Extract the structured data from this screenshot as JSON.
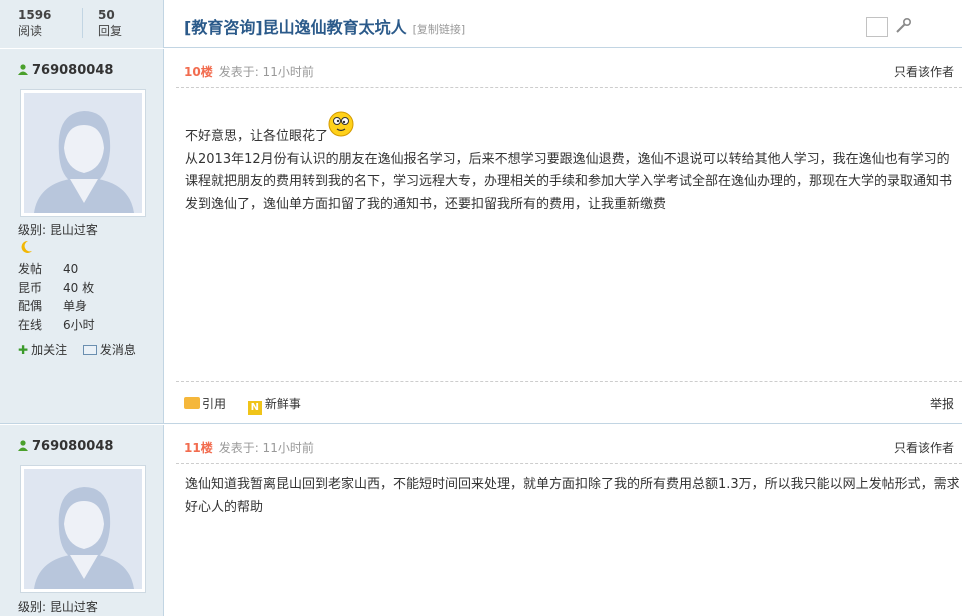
{
  "thread": {
    "views": "1596",
    "views_label": "阅读",
    "replies": "50",
    "replies_label": "回复",
    "title": "[教育咨询]昆山逸仙教育太坑人",
    "copy_link": "[复制链接]"
  },
  "posts": [
    {
      "author": "769080048",
      "level_label": "级别:",
      "level": "昆山过客",
      "stats": [
        {
          "k": "发帖",
          "v": "40"
        },
        {
          "k": "昆币",
          "v": "40 枚"
        },
        {
          "k": "配偶",
          "v": "单身"
        },
        {
          "k": "在线",
          "v": "6小时"
        }
      ],
      "follow": "加关注",
      "message_user": "发消息",
      "floor": "10楼",
      "posted": "发表于: 11小时前",
      "only_author": "只看该作者",
      "line1": "不好意思，让各位眼花了",
      "line2": "从2013年12月份有认识的朋友在逸仙报名学习，后来不想学习要跟逸仙退费，逸仙不退说可以转给其他人学习，我在逸仙也有学习的课程就把朋友的费用转到我的名下，学习远程大专，办理相关的手续和参加大学入学考试全部在逸仙办理的，那现在大学的录取通知书发到逸仙了，逸仙单方面扣留了我的通知书，还要扣留我所有的费用，让我重新缴费",
      "quote": "引用",
      "fresh": "新鲜事",
      "report": "举报"
    },
    {
      "author": "769080048",
      "level_label": "级别:",
      "level": "昆山过客",
      "floor": "11楼",
      "posted": "发表于: 11小时前",
      "only_author": "只看该作者",
      "line1": "逸仙知道我暂离昆山回到老家山西，不能短时间回来处理，就单方面扣除了我的所有费用总额1.3万，所以我只能以网上发帖形式，需求好心人的帮助"
    }
  ]
}
